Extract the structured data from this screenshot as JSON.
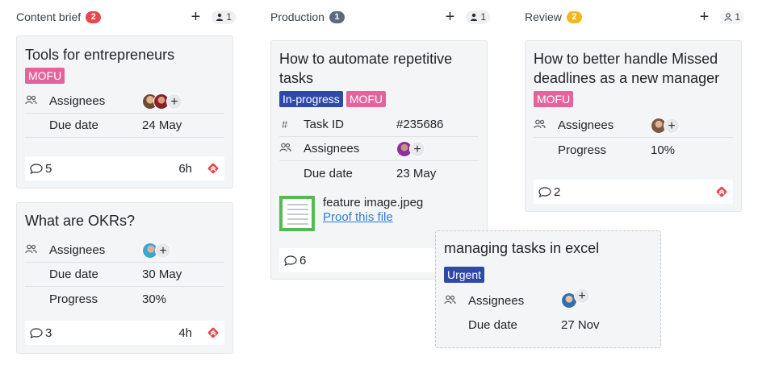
{
  "columns": [
    {
      "title": "Content brief",
      "count": "2",
      "count_color": "#e5484d",
      "users": "1"
    },
    {
      "title": "Production",
      "count": "1",
      "count_color": "#5a6b7b",
      "users": "1"
    },
    {
      "title": "Review",
      "count": "2",
      "count_color": "#f2b718",
      "users": "1"
    }
  ],
  "cards": {
    "tools": {
      "title": "Tools for entrepreneurs",
      "tags": [
        "MOFU"
      ],
      "assignees_label": "Assignees",
      "due_label": "Due date",
      "due": "24 May",
      "comments": "5",
      "time": "6h"
    },
    "okrs": {
      "title": "What are OKRs?",
      "assignees_label": "Assignees",
      "due_label": "Due date",
      "due": "30 May",
      "progress_label": "Progress",
      "progress": "30%",
      "comments": "3",
      "time": "4h"
    },
    "automate": {
      "title": "How to automate repetitive tasks",
      "tags": [
        "In-progress",
        "MOFU"
      ],
      "task_id_icon": "#",
      "task_id_label": "Task ID",
      "task_id": "#235686",
      "assignees_label": "Assignees",
      "due_label": "Due date",
      "due": "23 May",
      "file_name": "feature image.jpeg",
      "file_link": "Proof this file",
      "comments": "6"
    },
    "missed": {
      "title": "How to better handle Missed deadlines as a new manager",
      "tags": [
        "MOFU"
      ],
      "assignees_label": "Assignees",
      "progress_label": "Progress",
      "progress": "10%",
      "comments": "2"
    },
    "excel": {
      "title": "managing tasks in excel",
      "tags": [
        "Urgent"
      ],
      "assignees_label": "Assignees",
      "due_label": "Due date",
      "due": "27 Nov"
    }
  },
  "icons": {
    "add": "+",
    "assignees": "people-icon",
    "comment": "comment-icon",
    "priority": "priority-high-icon",
    "user": "user-icon"
  },
  "colors": {
    "mofu": "#e5639b",
    "blue_tag": "#2f49a8",
    "priority": "#e5484d",
    "link": "#2f7ecf"
  }
}
